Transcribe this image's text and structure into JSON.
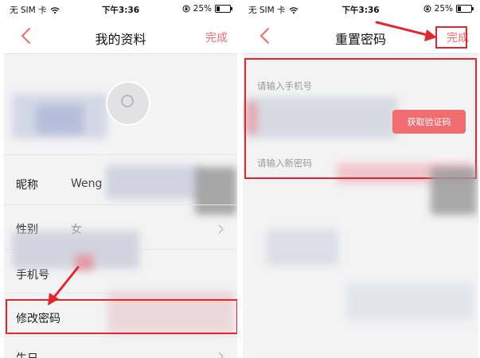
{
  "status_bar": {
    "carrier": "无 SIM 卡",
    "time": "下午3:36",
    "battery": "25%",
    "battery_level": 0.25
  },
  "left_screen": {
    "nav": {
      "back_icon": "chevron-left-icon",
      "title": "我的资料",
      "action": "完成"
    },
    "rows": {
      "nickname_label": "昵称",
      "nickname_value": "Weng",
      "gender_label": "性别",
      "gender_value": "女",
      "phone_label": "手机号",
      "change_password_label": "修改密码",
      "birthday_label": "生日"
    }
  },
  "right_screen": {
    "nav": {
      "back_icon": "chevron-left-icon",
      "title": "重置密码",
      "action": "完成"
    },
    "form": {
      "phone_placeholder": "请输入手机号",
      "get_code_button": "获取验证码",
      "new_password_placeholder": "请输入新密码"
    }
  },
  "colors": {
    "accent": "#f06a6f",
    "button": "#f26d72",
    "annotation": "#e0262e",
    "background": "#f3f3f4"
  }
}
